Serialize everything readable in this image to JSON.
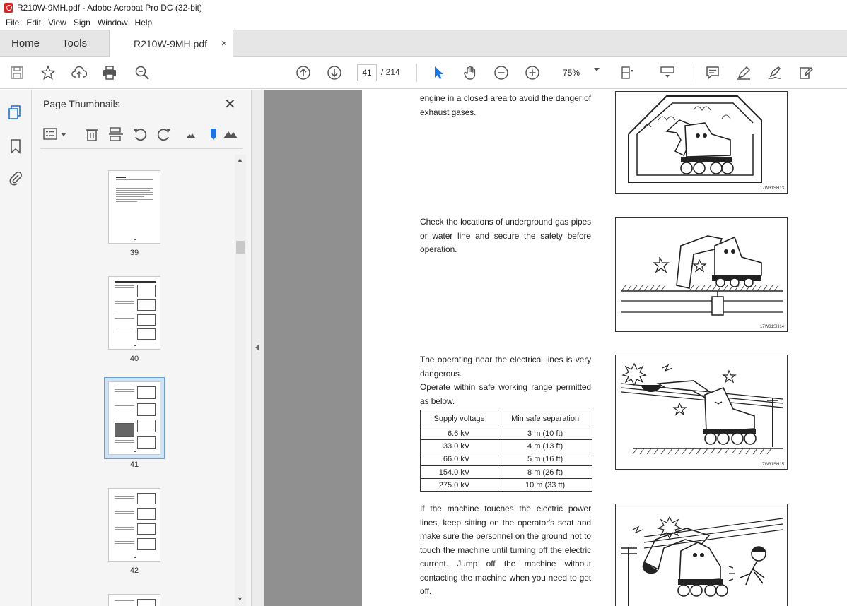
{
  "window": {
    "title": "R210W-9MH.pdf - Adobe Acrobat Pro DC (32-bit)"
  },
  "menu": [
    "File",
    "Edit",
    "View",
    "Sign",
    "Window",
    "Help"
  ],
  "tabs": {
    "home": "Home",
    "tools": "Tools",
    "document": "R210W-9MH.pdf",
    "close": "×"
  },
  "toolbar": {
    "current_page": "41",
    "total_pages": "/ 214",
    "zoom": "75%"
  },
  "thumbnails": {
    "title": "Page Thumbnails",
    "close": "✕",
    "pages": [
      "39",
      "40",
      "41",
      "42"
    ],
    "selected": "41"
  },
  "document": {
    "para1": "engine in a closed area to avoid the danger of exhaust gases.",
    "para2": "Check the locations of underground gas pipes or water line and secure the safety before operation.",
    "para3": "The operating near the electrical lines is very dangerous.",
    "para3b": "Operate within safe working range permitted as below.",
    "para4": "If the machine touches the electric power lines, keep sitting on the operator's seat and make sure the personnel on the ground not to touch the machine until turning off the electric current. Jump off the machine without contacting the machine when you need to get off.",
    "fig_codes": [
      "17W31SH13",
      "17W31SH14",
      "17W31SH15"
    ],
    "table": {
      "headers": [
        "Supply voltage",
        "Min safe separation"
      ],
      "rows": [
        [
          "6.6 kV",
          "3 m (10 ft)"
        ],
        [
          "33.0 kV",
          "4 m (13 ft)"
        ],
        [
          "66.0 kV",
          "5 m (16 ft)"
        ],
        [
          "154.0 kV",
          "8 m (26 ft)"
        ],
        [
          "275.0 kV",
          "10 m (33 ft)"
        ]
      ]
    }
  },
  "colors": {
    "accent": "#1a73e8",
    "doc_bg": "#909090",
    "tab_bg": "#e6e6e6"
  }
}
